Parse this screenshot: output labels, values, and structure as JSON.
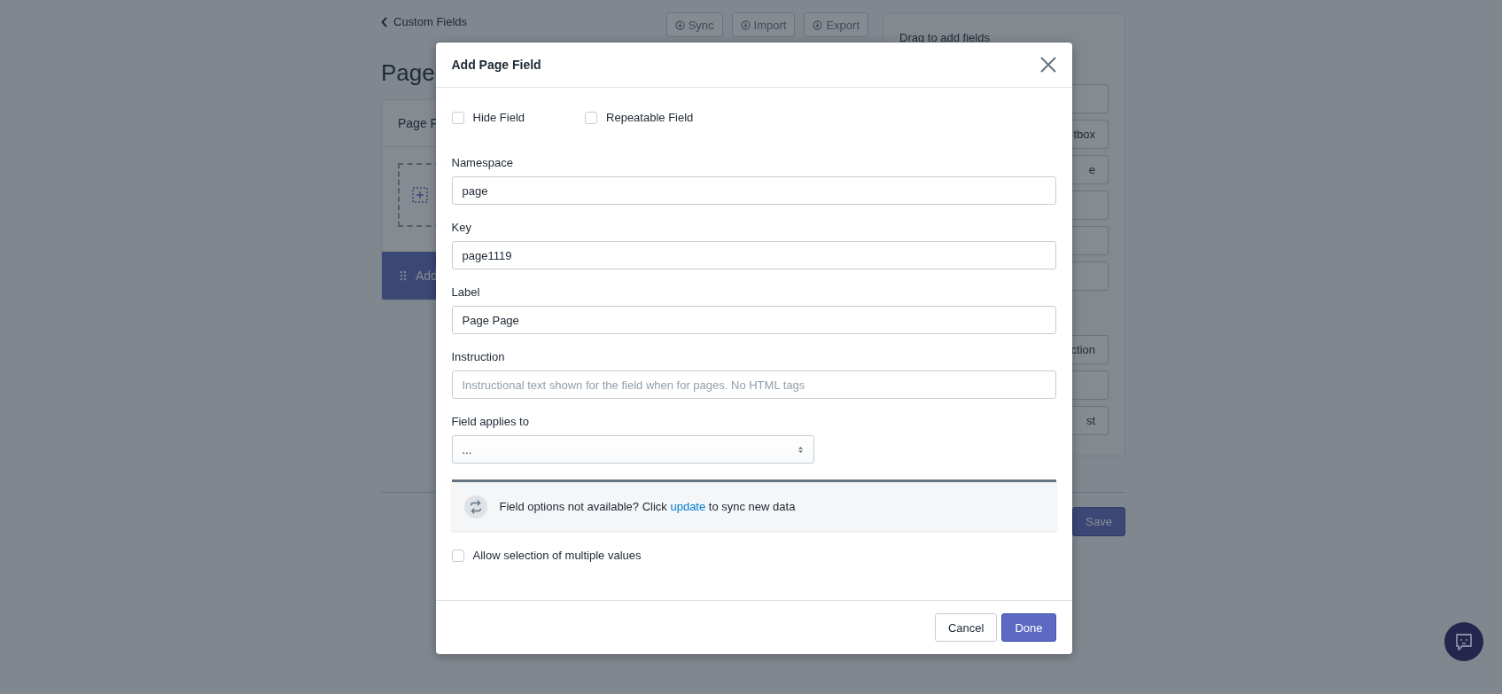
{
  "background": {
    "back_link": "Custom Fields",
    "actions": [
      "Sync",
      "Import",
      "Export"
    ],
    "heading": "Page",
    "card": {
      "title": "Page F",
      "add_bar": "Add"
    },
    "panel": {
      "title": "Drag to add fields",
      "groups": [
        {
          "items": [
            {
              "kind": "blank"
            },
            {
              "kind": "label",
              "label": "tbox"
            },
            {
              "kind": "label",
              "label": "e"
            },
            {
              "kind": "blank"
            },
            {
              "kind": "blank"
            },
            {
              "kind": "blank"
            }
          ]
        },
        {
          "items": [
            {
              "kind": "label",
              "label": "ction"
            },
            {
              "kind": "blank"
            },
            {
              "kind": "label",
              "label": "st"
            }
          ]
        }
      ]
    },
    "save_button": "Save"
  },
  "modal": {
    "title": "Add Page Field",
    "options": [
      {
        "label": "Hide Field",
        "checked": false
      },
      {
        "label": "Repeatable Field",
        "checked": false
      }
    ],
    "fields": [
      {
        "label": "Namespace",
        "value": "page"
      },
      {
        "label": "Key",
        "value": "page1119"
      },
      {
        "label": "Label",
        "value": "Page Page"
      },
      {
        "label": "Instruction",
        "placeholder": "Instructional text shown for the field when for pages. No HTML tags"
      }
    ],
    "select": {
      "label": "Field applies to",
      "value": "..."
    },
    "notice": {
      "before": "Field options not available? Click ",
      "link": "update",
      "after": " to sync new data"
    },
    "multiple": {
      "label": "Allow selection of multiple values",
      "checked": false
    },
    "buttons": {
      "cancel": "Cancel",
      "done": "Done"
    }
  }
}
